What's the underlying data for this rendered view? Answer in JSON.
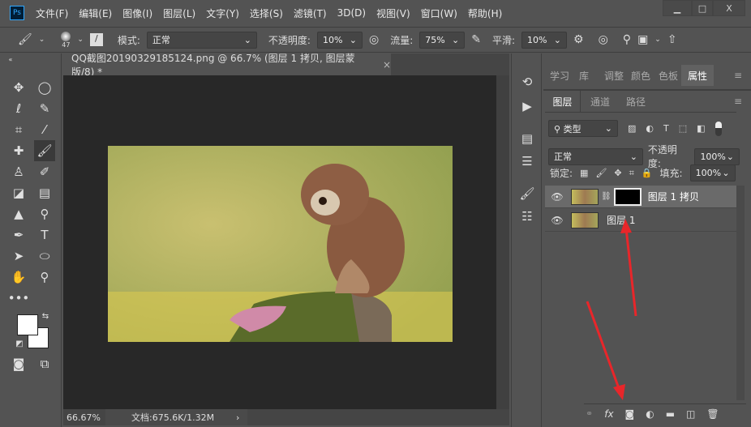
{
  "app": {
    "logo": "Ps"
  },
  "menu": [
    "文件(F)",
    "编辑(E)",
    "图像(I)",
    "图层(L)",
    "文字(Y)",
    "选择(S)",
    "滤镜(T)",
    "3D(D)",
    "视图(V)",
    "窗口(W)",
    "帮助(H)"
  ],
  "window": {
    "minimize": "▁",
    "maximize": "□",
    "close": "X"
  },
  "options": {
    "brush_size": "47",
    "mode_label": "模式:",
    "mode_value": "正常",
    "opacity_label": "不透明度:",
    "opacity_value": "10%",
    "flow_label": "流量:",
    "flow_value": "75%",
    "smooth_label": "平滑:",
    "smooth_value": "10%"
  },
  "document": {
    "tab_title": "QQ截图20190329185124.png @ 66.7% (图层 1 拷贝, 图层蒙版/8) *",
    "close": "×",
    "zoom": "66.67%",
    "doc_info": "文档:675.6K/1.32M",
    "arrow": "›"
  },
  "panels": {
    "top_tabs": [
      "学习",
      "库",
      "调整",
      "颜色",
      "色板",
      "属性"
    ],
    "layer_tabs": [
      "图层",
      "通道",
      "路径"
    ],
    "filter_kind": "类型",
    "blend_mode": "正常",
    "opacity_label": "不透明度:",
    "opacity_value": "100%",
    "lock_label": "锁定:",
    "fill_label": "填充:",
    "fill_value": "100%"
  },
  "layers": [
    {
      "name": "图层 1 拷贝",
      "selected": true,
      "has_mask": true
    },
    {
      "name": "图层 1",
      "selected": false,
      "has_mask": false
    }
  ],
  "colors": {
    "accent_red": "#e8262a",
    "ps_blue": "#31a8ff"
  }
}
